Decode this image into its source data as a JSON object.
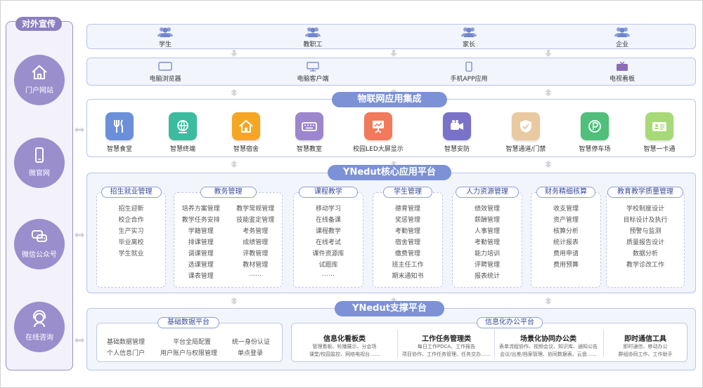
{
  "left": {
    "title": "对外宣传",
    "items": [
      "门户网站",
      "微官网",
      "微信公众号",
      "在线咨询"
    ]
  },
  "users": [
    "学生",
    "教职工",
    "家长",
    "企业"
  ],
  "terminals": [
    "电脑浏览器",
    "电脑客户端",
    "手机APP应用",
    "电视看板"
  ],
  "iot": {
    "title": "物联网应用集成",
    "apps": [
      {
        "name": "智慧食堂",
        "color": "#6b8fd9"
      },
      {
        "name": "智慧终端",
        "color": "#3dbb9f"
      },
      {
        "name": "智慧宿舍",
        "color": "#f5a623"
      },
      {
        "name": "智慧教室",
        "color": "#9c86cc"
      },
      {
        "name": "校园LED大屏显示",
        "color": "#f07a5a"
      },
      {
        "name": "智慧安防",
        "color": "#7a72c8"
      },
      {
        "name": "智慧通道/门禁",
        "color": "#e8c9a0"
      },
      {
        "name": "智慧停车场",
        "color": "#4fbf7a"
      },
      {
        "name": "智慧一卡通",
        "color": "#a8d977"
      }
    ]
  },
  "core": {
    "title": "YNedut核心应用平台",
    "modules": [
      {
        "title": "招生就业管理",
        "col1": [
          "招生迎新",
          "校企合作",
          "生产实习",
          "毕业离校",
          "学生就业"
        ],
        "col2": []
      },
      {
        "title": "教务管理",
        "col1": [
          "培养方案管理",
          "教学任务安排",
          "学籍管理",
          "排课管理",
          "调课管理",
          "选课管理",
          "课表管理"
        ],
        "col2": [
          "教学常规管理",
          "技能鉴定管理",
          "考务管理",
          "成绩管理",
          "评教管理",
          "教材管理",
          "……"
        ]
      },
      {
        "title": "课程教学",
        "col1": [
          "移动学习",
          "在线备课",
          "课程教学",
          "在线考试",
          "课件资源库",
          "试题库",
          "……"
        ],
        "col2": []
      },
      {
        "title": "学生管理",
        "col1": [
          "德育管理",
          "奖惩管理",
          "考勤管理",
          "宿舍管理",
          "缴费管理",
          "班主任工作",
          "期末通知书"
        ],
        "col2": []
      },
      {
        "title": "人力资源管理",
        "col1": [
          "绩效管理",
          "薪酬管理",
          "人事管理",
          "考勤管理",
          "能力培训",
          "评聘管理",
          "报表统计"
        ],
        "col2": []
      },
      {
        "title": "财务精细核算",
        "col1": [
          "收支管理",
          "资产管理",
          "核算分析",
          "统计报表",
          "费用申请",
          "费用预算"
        ],
        "col2": []
      },
      {
        "title": "教育教学质量管理",
        "col1": [
          "学校制度设计",
          "目标设计及执行",
          "预警与监测",
          "质量报告设计",
          "数据分析",
          "教学诊改工作"
        ],
        "col2": []
      }
    ]
  },
  "support": {
    "title": "YNedut支撑平台",
    "basic": {
      "title": "基础数据平台",
      "items": [
        "基础数据管理",
        "平台全局配置",
        "统一身份认证",
        "个人信息门户",
        "用户账户与权限管理",
        "单点登录"
      ]
    },
    "office": {
      "title": "信息化办公平台",
      "cards": [
        {
          "title": "信息化看板类",
          "desc": [
            "管理看板、轮播展示、分会场",
            "课堂/校园监控、网络电视台……"
          ]
        },
        {
          "title": "工作任务管理类",
          "desc": [
            "每日工作PDCA、工作报告",
            "项目协作、工作任务管理、任务交办……"
          ]
        },
        {
          "title": "场景化协同办公类",
          "desc": [
            "表单流程协作、视频会议、知识库、通知公告",
            "会议/出差/档案管理、协同数据表、云盘……"
          ]
        },
        {
          "title": "即时通信工具",
          "desc": [
            "即时通信、移动办公",
            "群组协同工作、工作助手"
          ]
        }
      ]
    }
  },
  "colors": {
    "accent": "#7c91d6",
    "left_accent": "#9a8fcc",
    "border": "#b9c3e8"
  }
}
